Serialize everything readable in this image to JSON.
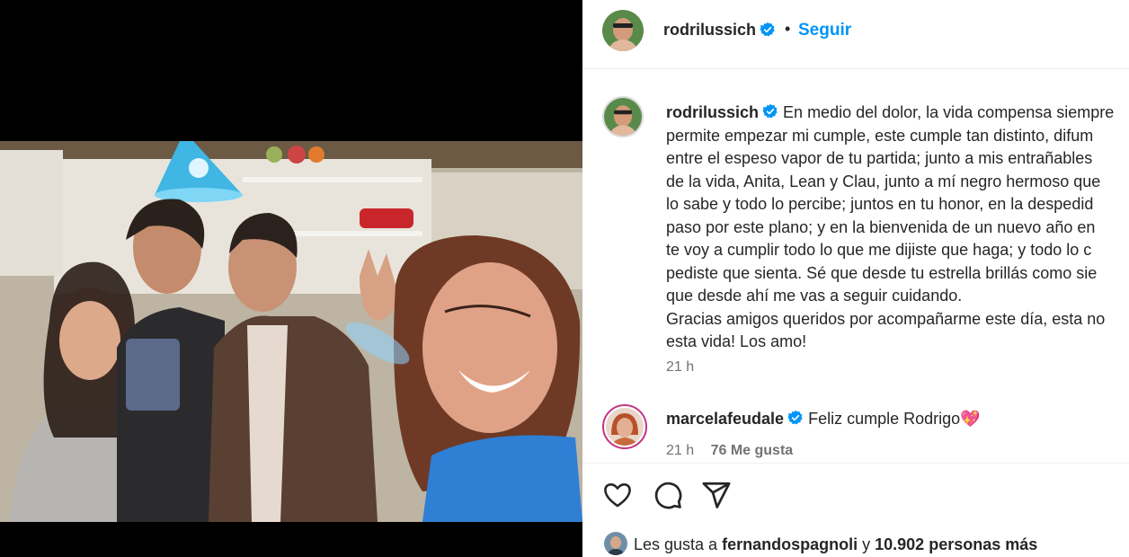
{
  "post": {
    "author": "rodrilussich",
    "follow_label": "Seguir",
    "separator": "•",
    "caption_lines": [
      "En medio del dolor, la vida compensa siempre",
      "permite empezar mi cumple, este cumple tan distinto, difum",
      "entre el espeso vapor de tu partida; junto a mis entrañables",
      "de la vida, Anita, Lean y Clau, junto a mí negro hermoso que",
      "lo sabe y todo lo percibe; juntos en tu honor, en la despedid",
      "paso por este plano; y en la bienvenida de un nuevo año en",
      "te voy a cumplir todo lo que me dijiste que haga; y todo lo c",
      "pediste que sienta. Sé que desde tu estrella brillás como sie",
      "que desde ahí me vas a seguir cuidando.",
      "Gracias amigos queridos por acompañarme este día, esta no",
      "esta vida! Los amo!"
    ],
    "caption_time": "21 h"
  },
  "comment": {
    "author": "marcelafeudale",
    "text": "Feliz cumple Rodrigo",
    "emoji": "💖",
    "time": "21 h",
    "likes": "76 Me gusta"
  },
  "likes": {
    "prefix": "Les gusta a",
    "user": "fernandospagnoli",
    "connector": "y",
    "others": "10.902 personas más"
  },
  "icons": {
    "verified": "verified-badge-icon",
    "like": "heart-icon",
    "comment": "comment-bubble-icon",
    "share": "paper-plane-icon"
  },
  "colors": {
    "link": "#0095f6",
    "verified": "#0095f6",
    "muted": "#737373",
    "text": "#262626"
  }
}
